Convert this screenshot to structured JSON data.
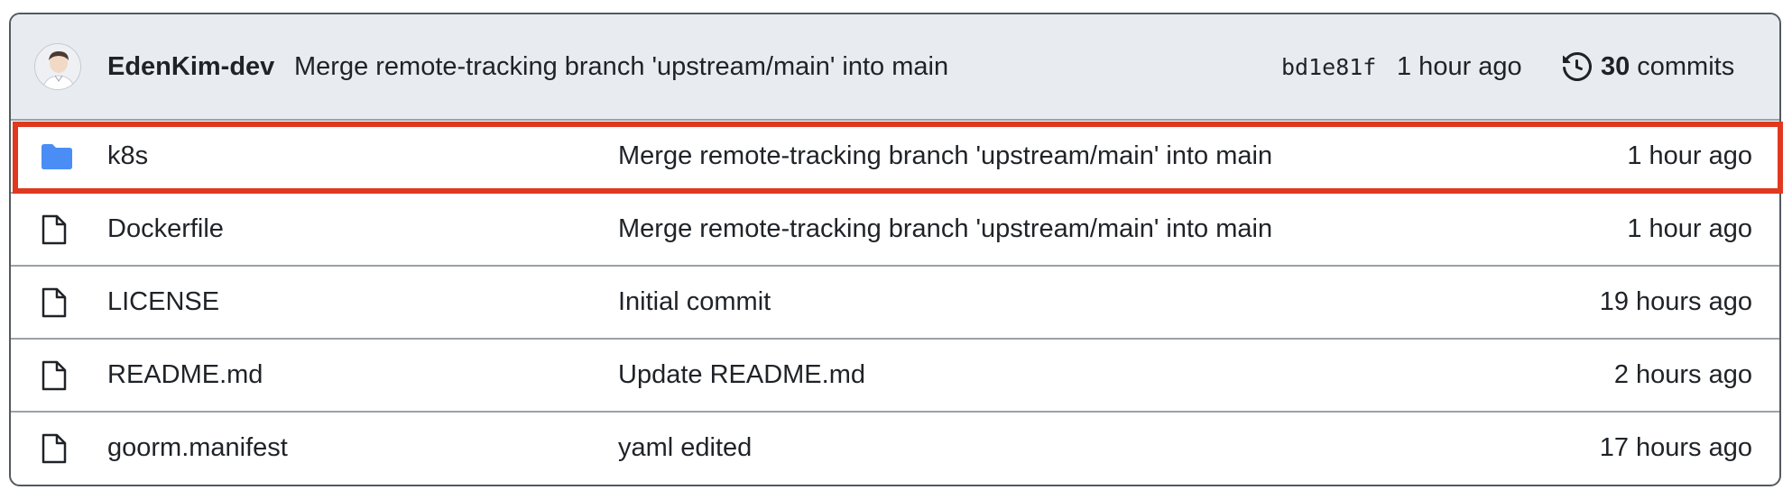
{
  "latest_commit": {
    "author": "EdenKim-dev",
    "message": "Merge remote-tracking branch 'upstream/main' into main",
    "sha": "bd1e81f",
    "time": "1 hour ago",
    "history_icon": "history-icon",
    "commit_count": "30",
    "commits_label": "commits"
  },
  "files": [
    {
      "type": "folder",
      "icon": "folder-icon",
      "name": "k8s",
      "message": "Merge remote-tracking branch 'upstream/main' into main",
      "time": "1 hour ago"
    },
    {
      "type": "file",
      "icon": "file-icon",
      "name": "Dockerfile",
      "message": "Merge remote-tracking branch 'upstream/main' into main",
      "time": "1 hour ago"
    },
    {
      "type": "file",
      "icon": "file-icon",
      "name": "LICENSE",
      "message": "Initial commit",
      "time": "19 hours ago"
    },
    {
      "type": "file",
      "icon": "file-icon",
      "name": "README.md",
      "message": "Update README.md",
      "time": "2 hours ago"
    },
    {
      "type": "file",
      "icon": "file-icon",
      "name": "goorm.manifest",
      "message": "yaml edited",
      "time": "17 hours ago"
    }
  ],
  "colors": {
    "folder": "#4a8df5",
    "header_bg": "#e8ecf0",
    "highlight": "#e0391f"
  }
}
